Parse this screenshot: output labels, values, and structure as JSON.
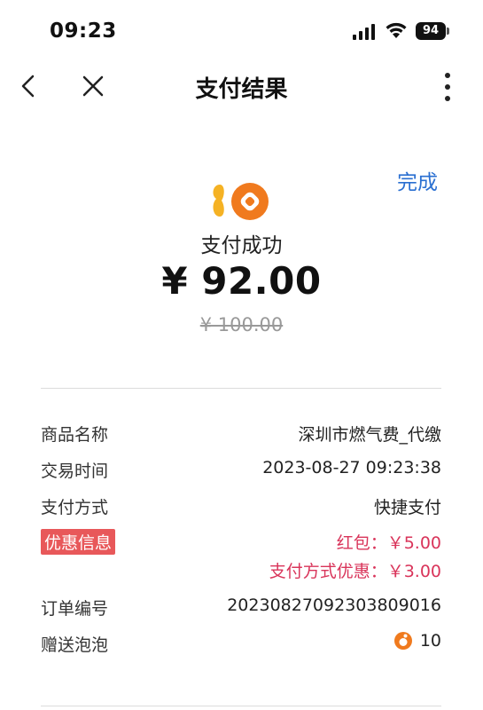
{
  "status_bar": {
    "time": "09:23",
    "battery": "94"
  },
  "nav": {
    "title": "支付结果"
  },
  "done_label": "完成",
  "result": {
    "status": "支付成功",
    "amount": "¥ 92.00",
    "original_amount": "¥ 100.00"
  },
  "details": {
    "product_label": "商品名称",
    "product_value": "深圳市燃气费_代缴",
    "time_label": "交易时间",
    "time_value": "2023-08-27 09:23:38",
    "method_label": "支付方式",
    "method_value": "快捷支付",
    "discount_label": "优惠信息",
    "discount_red_packet": "红包：￥5.00",
    "discount_method": "支付方式优惠：￥3.00",
    "order_label": "订单编号",
    "order_value": "2023082709230380 9016",
    "bubbles_label": "赠送泡泡",
    "bubbles_value": "10"
  },
  "colors": {
    "accent_blue": "#2a6fd1",
    "discount_red": "#d9345a",
    "logo_orange": "#f07a1e",
    "logo_yellow": "#f5b224"
  }
}
